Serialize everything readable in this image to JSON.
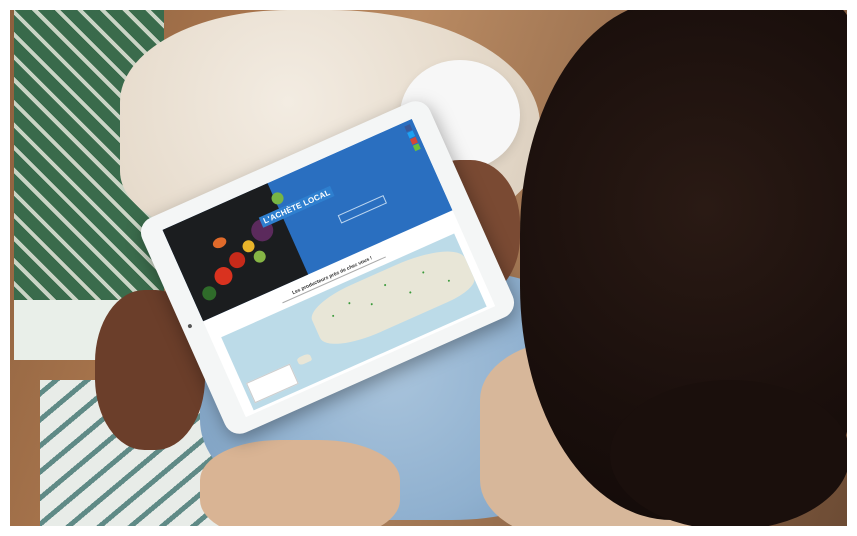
{
  "tablet_screen": {
    "brand_logo_text": "L'ACHÈTE LOCAL",
    "hero_paragraph": "",
    "hero_button": "",
    "map_heading": "Les producteurs près de chez vous !",
    "map_legend_title": "",
    "social_buttons": [
      "facebook",
      "twitter",
      "email",
      "share"
    ]
  },
  "colors": {
    "hero_blue": "#2a6fc0",
    "brand_green": "#77b544",
    "map_water": "#bcdbe8"
  }
}
